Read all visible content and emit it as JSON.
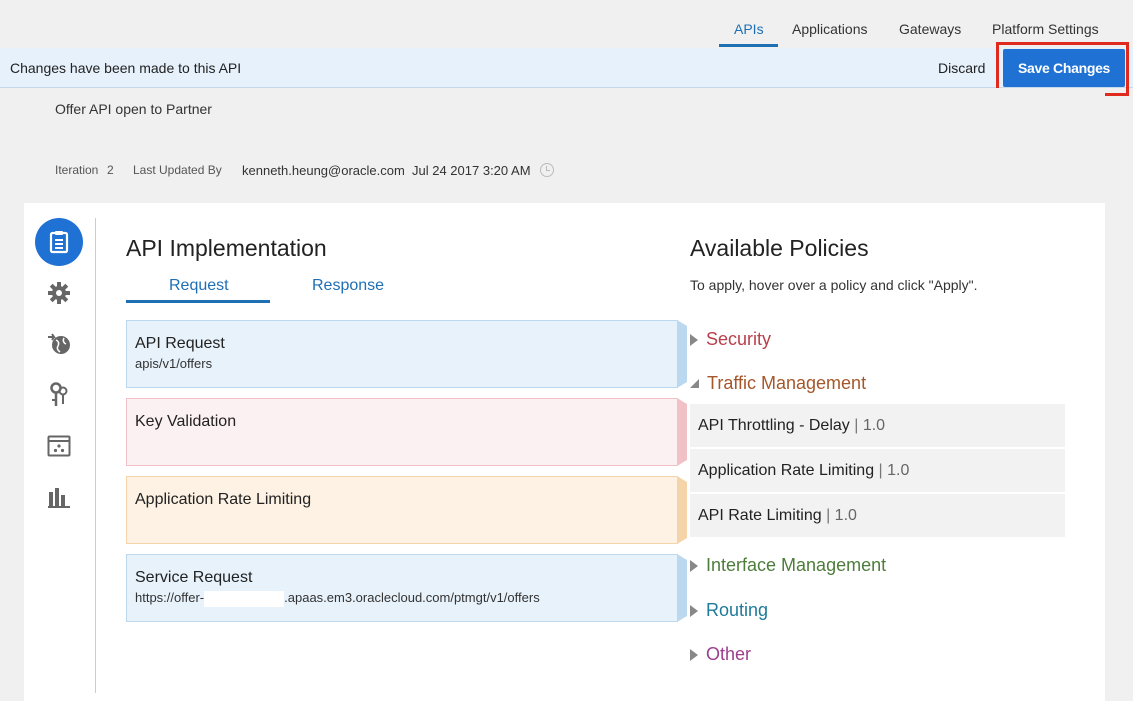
{
  "topnav": {
    "tabs": [
      {
        "label": "APIs",
        "active": true
      },
      {
        "label": "Applications"
      },
      {
        "label": "Gateways"
      },
      {
        "label": "Platform Settings"
      }
    ]
  },
  "changebar": {
    "message": "Changes have been made to this API",
    "discard_label": "Discard",
    "save_label": "Save Changes"
  },
  "info": {
    "description": "Offer API open to Partner",
    "iteration_label": "Iteration",
    "iteration_value": "2",
    "updated_by_label": "Last Updated By",
    "updated_by": "kenneth.heung@oracle.com",
    "updated_at": "Jul 24 2017 3:20 AM"
  },
  "implementation": {
    "title": "API Implementation",
    "tabs": [
      "Request",
      "Response"
    ],
    "steps": [
      {
        "title": "API Request",
        "subtitle": "apis/v1/offers",
        "bg": "#e7f2fb",
        "border": "#bcd8ef"
      },
      {
        "title": "Key Validation",
        "subtitle": "",
        "bg": "#fcf1f2",
        "border": "#f0c2c7"
      },
      {
        "title": "Application Rate Limiting",
        "subtitle": "",
        "bg": "#fdf2e3",
        "border": "#f4d4a8"
      },
      {
        "title": "Service Request",
        "subtitle_prefix": "https://offer-",
        "subtitle_suffix": ".apaas.em3.oraclecloud.com/ptmgt/v1/offers",
        "bg": "#e7f2fb",
        "border": "#bcd8ef"
      }
    ]
  },
  "policies": {
    "title": "Available Policies",
    "hint": "To apply, hover over a policy and click \"Apply\".",
    "categories": [
      {
        "label": "Security",
        "color": "#b8404b"
      },
      {
        "label": "Traffic Management",
        "color": "#a5572a"
      },
      {
        "label": "Interface Management",
        "color": "#4e7c3b"
      },
      {
        "label": "Routing",
        "color": "#1f7a99"
      },
      {
        "label": "Other",
        "color": "#9c3e8e"
      }
    ],
    "traffic_items": [
      {
        "name": "API Throttling - Delay",
        "version": "1.0"
      },
      {
        "name": "Application Rate Limiting",
        "version": "1.0"
      },
      {
        "name": "API Rate Limiting",
        "version": "1.0"
      }
    ]
  },
  "rail_icons": [
    "api-details-icon",
    "settings-icon",
    "globe-icon",
    "keys-icon",
    "deployment-icon",
    "analytics-icon"
  ]
}
